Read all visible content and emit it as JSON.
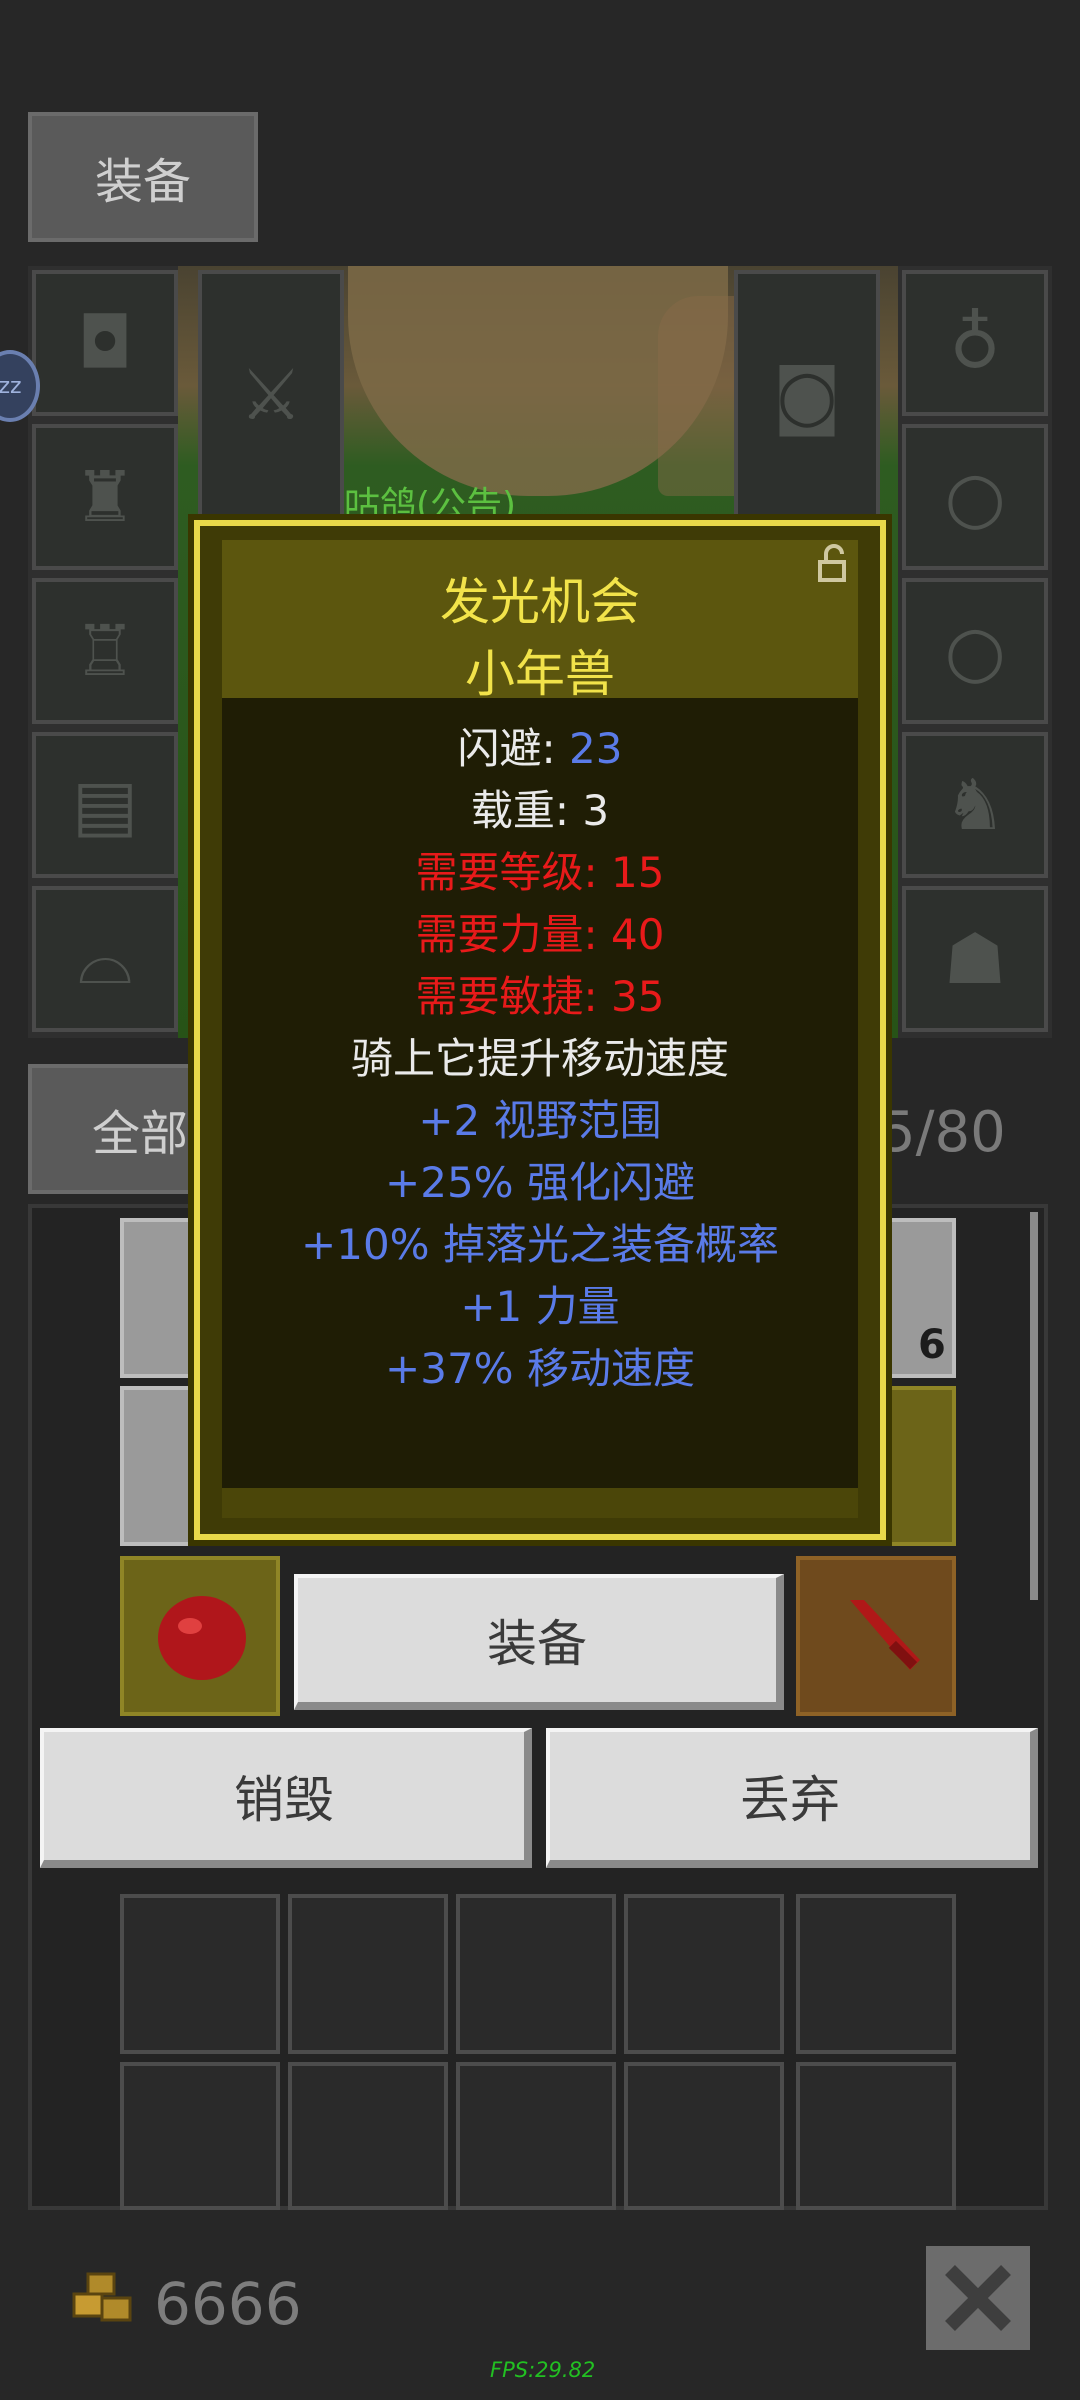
{
  "tab": {
    "label": "装备"
  },
  "scene": {
    "npc_label": "咕咕鸽(公告)"
  },
  "sleep_badge": "zz",
  "equipment_slots_left": [
    "helmet-icon",
    "armor-icon",
    "glove-icon",
    "belt-icon",
    "boots-icon"
  ],
  "equipment_slots_right": [
    "amulet-icon",
    "ring-icon",
    "ring-icon",
    "mount-icon",
    "pet-icon"
  ],
  "filter": {
    "label": "全部",
    "capacity": "5/80"
  },
  "inventory": {
    "stack_count": "6"
  },
  "tooltip": {
    "title": "发光机会",
    "subtitle": "小年兽",
    "lines": [
      {
        "label": "闪避: ",
        "value": "23"
      },
      {
        "text": "载重: 3"
      },
      {
        "text": "需要等级: 15"
      },
      {
        "text": "需要力量: 40"
      },
      {
        "text": "需要敏捷: 35"
      },
      {
        "text": "骑上它提升移动速度"
      },
      {
        "text": "+2 视野范围"
      },
      {
        "text": "+25% 强化闪避"
      },
      {
        "text": "+10% 掉落光之装备概率"
      },
      {
        "text": "+1 力量"
      },
      {
        "text": "+37% 移动速度"
      }
    ]
  },
  "actions": {
    "equip": "装备",
    "destroy": "销毁",
    "discard": "丢弃"
  },
  "footer": {
    "gold": "6666",
    "fps": "FPS:29.82"
  },
  "colors": {
    "tooltip_border": "#e8d84a",
    "requirement": "#e81a1a",
    "bonus": "#5a7be8",
    "title": "#f2e34a"
  }
}
